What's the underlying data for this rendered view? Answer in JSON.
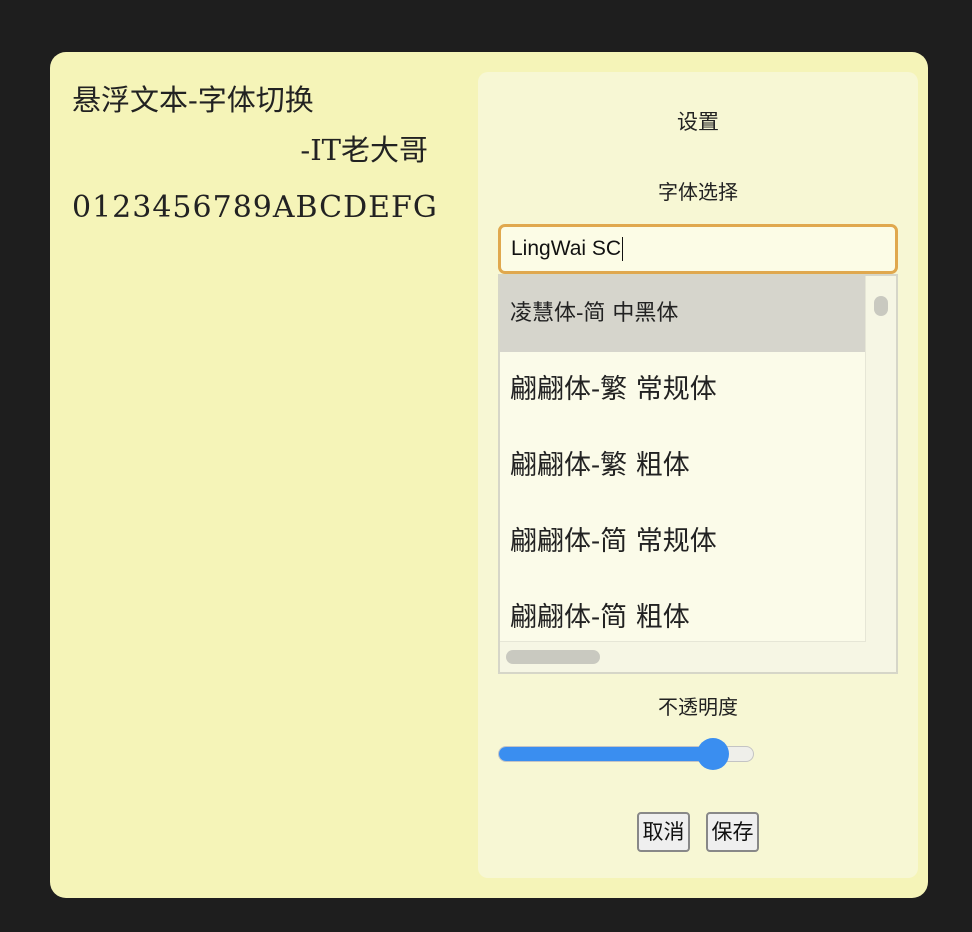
{
  "note": {
    "title": "悬浮文本-字体切换",
    "author": "-IT老大哥",
    "digits": "0123456789ABCDEFG"
  },
  "settings": {
    "title": "设置",
    "font_label": "字体选择",
    "font_input_value": "LingWai SC",
    "font_options": [
      "凌慧体-简 中黑体",
      "翩翩体-繁 常规体",
      "翩翩体-繁 粗体",
      "翩翩体-简 常规体",
      "翩翩体-简 粗体"
    ],
    "selected_index": 0,
    "opacity_label": "不透明度",
    "opacity_value": 0.84,
    "cancel_label": "取消",
    "save_label": "保存"
  },
  "colors": {
    "window_bg": "#f5f4b8",
    "panel_bg": "#f7f7d4",
    "input_border": "#e0a84e",
    "slider_accent": "#3a8ef0",
    "selected_option_bg": "#d6d5cc"
  }
}
